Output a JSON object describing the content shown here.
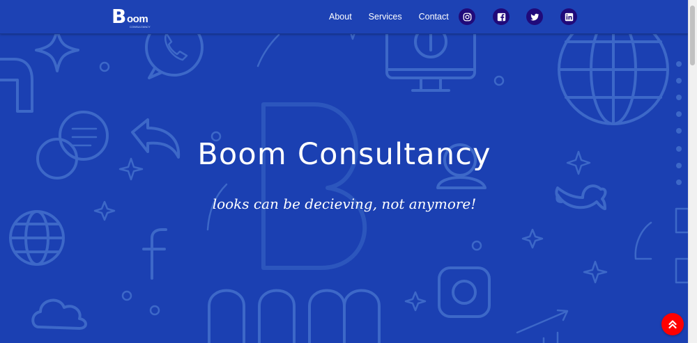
{
  "brand": {
    "logo_mark": "B",
    "logo_text": "oom",
    "logo_sub": "CONSULTANCY"
  },
  "nav": {
    "links": [
      {
        "label": "About"
      },
      {
        "label": "Services"
      },
      {
        "label": "Contact"
      }
    ],
    "social": [
      {
        "icon": "instagram-icon"
      },
      {
        "icon": "facebook-icon"
      },
      {
        "icon": "twitter-icon"
      },
      {
        "icon": "linkedin-icon"
      }
    ]
  },
  "hero": {
    "title": "Boom Consultancy",
    "tagline": "looks can be decieving, not anymore!"
  },
  "scroll_to_top": {
    "icon": "double-chevron-up-icon"
  },
  "colors": {
    "background": "#1b40b2",
    "pattern": "#3d68c8",
    "social_bg": "#200a7a",
    "to_top_bg": "#ff0000"
  }
}
